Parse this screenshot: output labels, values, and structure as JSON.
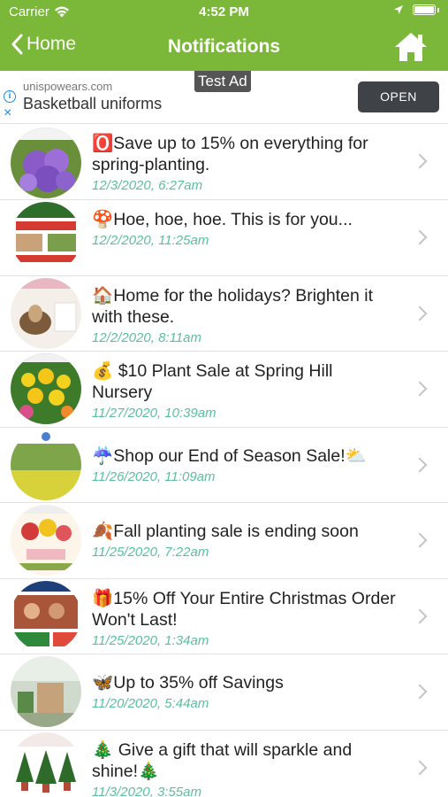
{
  "status": {
    "carrier": "Carrier",
    "time": "4:52 PM"
  },
  "nav": {
    "back_label": "Home",
    "title": "Notifications",
    "accent": "#7bb83a"
  },
  "ad": {
    "tag": "Test Ad",
    "domain": "unispowears.com",
    "headline": "Basketball uniforms",
    "cta": "OPEN",
    "info_icon": "i",
    "close_icon": "×"
  },
  "notifications": [
    {
      "title": "🅾️",
      "text": "Save up to 15% on everything for spring-planting.",
      "date": "12/3/2020, 6:27am",
      "thumb": "purple-flowers"
    },
    {
      "title": "🍄",
      "text": "Hoe, hoe, hoe. This is for you...",
      "date": "12/2/2020, 11:25am",
      "thumb": "gurneys"
    },
    {
      "title": "🏠",
      "text": "Home for the holidays? Brighten it with these.",
      "date": "12/2/2020, 8:11am",
      "thumb": "bulb-pot"
    },
    {
      "title": "💰",
      "text": " $10 Plant Sale at Spring Hill Nursery",
      "date": "11/27/2020, 10:39am",
      "thumb": "yellow-flowers"
    },
    {
      "title": "☔",
      "text": "Shop our End of Season Sale!⛅",
      "date": "11/26/2020, 11:09am",
      "thumb": "field"
    },
    {
      "title": "🍂",
      "text": "Fall planting sale is ending soon",
      "date": "11/25/2020, 7:22am",
      "thumb": "free-shipping"
    },
    {
      "title": "🎁",
      "text": "15% Off Your Entire Christmas Order Won't Last!",
      "date": "11/25/2020, 1:34am",
      "thumb": "christmas-order"
    },
    {
      "title": "🦋",
      "text": "Up to 35% off Savings",
      "date": "11/20/2020, 5:44am",
      "thumb": "greenhouse"
    },
    {
      "title": "🎄",
      "text": " Give a gift that will sparkle and shine!🎄",
      "date": "11/3/2020, 3:55am",
      "thumb": "trees"
    }
  ]
}
